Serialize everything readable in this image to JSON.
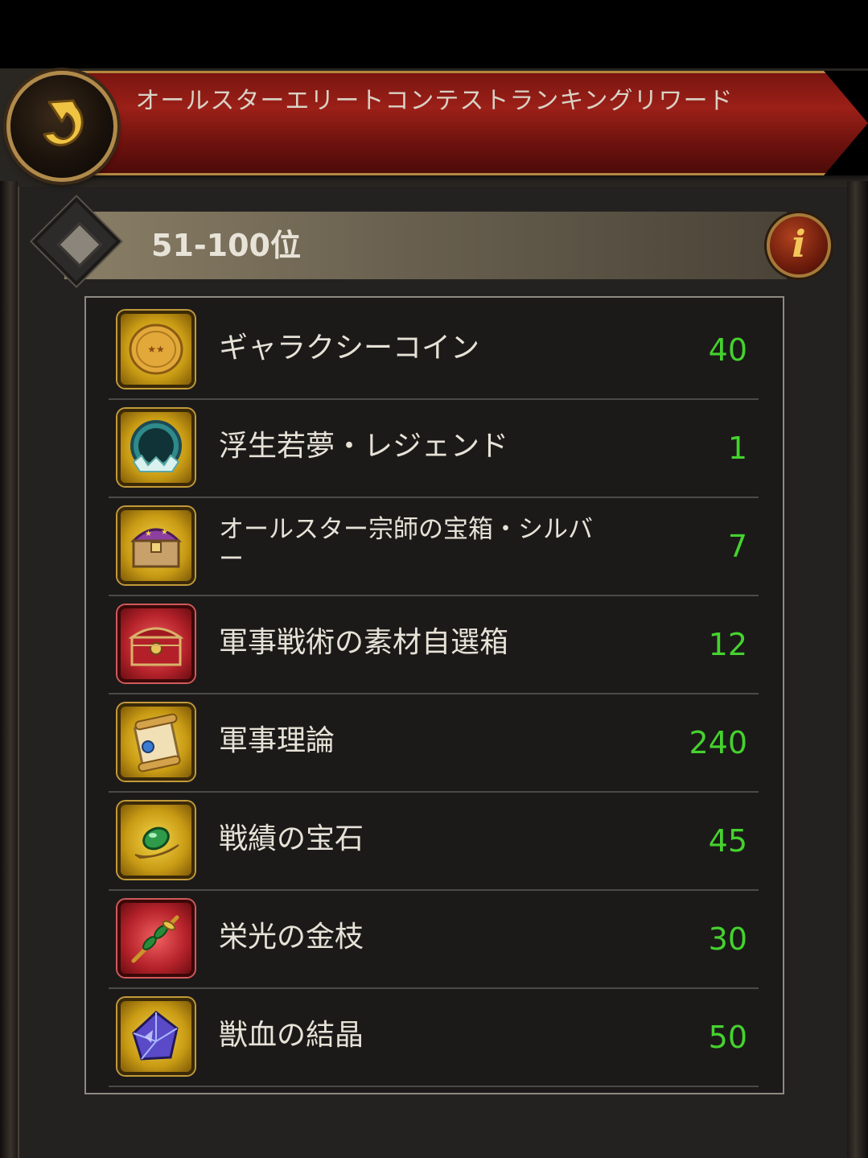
{
  "header": {
    "title": "オールスターエリートコンテストランキングリワード"
  },
  "rank": {
    "label": "51-100位"
  },
  "info_glyph": "i",
  "rewards": [
    {
      "name": "ギャラクシーコイン",
      "qty": "40",
      "icon": "all-star-coin-icon",
      "frame": "gold"
    },
    {
      "name": "浮生若夢・レジェンド",
      "qty": "1",
      "icon": "legend-mirror-icon",
      "frame": "gold"
    },
    {
      "name": "オールスター宗師の宝箱・シルバー",
      "qty": "7",
      "icon": "treasure-chest-icon",
      "frame": "gold"
    },
    {
      "name": "軍事戦術の素材自選箱",
      "qty": "12",
      "icon": "red-chest-icon",
      "frame": "red"
    },
    {
      "name": "軍事理論",
      "qty": "240",
      "icon": "scroll-icon",
      "frame": "gold"
    },
    {
      "name": "戦績の宝石",
      "qty": "45",
      "icon": "green-gem-icon",
      "frame": "gold"
    },
    {
      "name": "栄光の金枝",
      "qty": "30",
      "icon": "golden-branch-icon",
      "frame": "red"
    },
    {
      "name": "獣血の結晶",
      "qty": "50",
      "icon": "crystal-icon",
      "frame": "gold"
    }
  ],
  "colors": {
    "quantity": "#45d22e",
    "header_red": "#9b2018",
    "frame_gold": "#c29a3a"
  }
}
